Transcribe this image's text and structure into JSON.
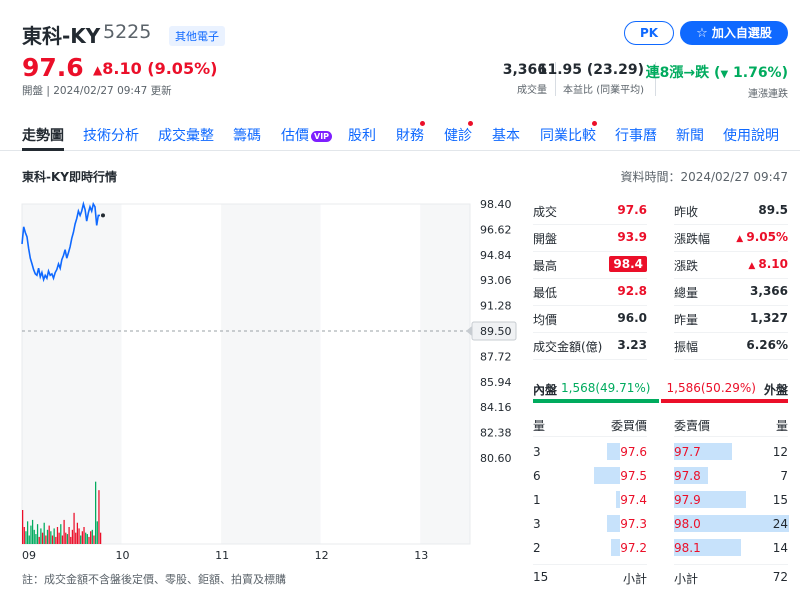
{
  "header": {
    "name": "東科-KY",
    "code": "5225",
    "category": "其他電子",
    "price": "97.6",
    "change": "8.10 (9.05%)",
    "status": "開盤 | 2024/02/27 09:47 更新",
    "pk_label": "PK",
    "watch_label": "加入自選股",
    "stats": [
      {
        "value": "3,366",
        "label": "成交量"
      },
      {
        "value": "11.95 (23.29)",
        "label": "本益比 (同業平均)"
      },
      {
        "value_prefix": "連8漲→跌 (",
        "value_change": "1.76%",
        "value_suffix": ")",
        "label": "連漲連跌"
      }
    ]
  },
  "tabs": [
    {
      "label": "走勢圖",
      "active": true
    },
    {
      "label": "技術分析"
    },
    {
      "label": "成交彙整"
    },
    {
      "label": "籌碼"
    },
    {
      "label": "估價",
      "badge": "VIP"
    },
    {
      "label": "股利"
    },
    {
      "label": "財務",
      "dot": true
    },
    {
      "label": "健診",
      "dot": true
    },
    {
      "label": "基本"
    },
    {
      "label": "同業比較",
      "dot": true
    },
    {
      "label": "行事曆"
    },
    {
      "label": "新聞"
    },
    {
      "label": "使用說明"
    }
  ],
  "section_title": "東科-KY即時行情",
  "data_time": "資料時間：2024/02/27 09:47",
  "footnote": "註：成交金額不含盤後定價、零股、鉅額、拍賣及標購",
  "chart_data": {
    "type": "line",
    "y_ticks": [
      "98.40",
      "96.62",
      "94.84",
      "93.06",
      "91.28",
      "89.50",
      "87.72",
      "85.94",
      "84.16",
      "82.38",
      "80.60"
    ],
    "ylim": [
      80.6,
      98.4
    ],
    "reference": "89.50",
    "x_ticks": [
      "09",
      "10",
      "11",
      "12",
      "13"
    ],
    "price_series": {
      "x_minutes": [
        0,
        1,
        2,
        3,
        4,
        5,
        6,
        7,
        8,
        9,
        10,
        11,
        12,
        13,
        14,
        15,
        16,
        17,
        18,
        19,
        20,
        21,
        22,
        23,
        24,
        25,
        26,
        27,
        28,
        29,
        30,
        31,
        32,
        33,
        34,
        35,
        36,
        37,
        38,
        39,
        40,
        41,
        42,
        43,
        44,
        45,
        46,
        47
      ],
      "values": [
        95.6,
        96.8,
        96.4,
        96.1,
        95.3,
        94.6,
        94.2,
        93.8,
        93.5,
        93.4,
        93.9,
        93.3,
        93.6,
        93.1,
        93.4,
        93.2,
        93.7,
        93.4,
        93.5,
        93.2,
        93.6,
        93.8,
        94.2,
        93.9,
        94.5,
        94.8,
        95.2,
        94.6,
        95.0,
        95.4,
        96.0,
        96.4,
        97.0,
        97.4,
        97.9,
        97.6,
        97.9,
        98.4,
        98.0,
        97.2,
        97.8,
        98.2,
        97.9,
        98.4,
        98.2,
        96.9,
        97.6,
        97.6
      ]
    },
    "volume_series": {
      "x_minutes": [
        0,
        1,
        2,
        3,
        4,
        5,
        6,
        7,
        8,
        9,
        10,
        11,
        12,
        13,
        14,
        15,
        16,
        17,
        18,
        19,
        20,
        21,
        22,
        23,
        24,
        25,
        26,
        27,
        28,
        29,
        30,
        31,
        32,
        33,
        34,
        35,
        36,
        37,
        38,
        39,
        40,
        41,
        42,
        43,
        44,
        45,
        46,
        47
      ],
      "values": [
        120,
        60,
        45,
        80,
        30,
        65,
        85,
        50,
        35,
        70,
        25,
        55,
        40,
        75,
        30,
        50,
        65,
        45,
        30,
        55,
        25,
        60,
        40,
        70,
        30,
        85,
        40,
        35,
        60,
        25,
        50,
        110,
        40,
        75,
        55,
        30,
        45,
        60,
        40,
        35,
        25,
        45,
        50,
        30,
        220,
        80,
        190,
        40
      ],
      "vmax": 240
    }
  },
  "quote": {
    "left": [
      {
        "label": "成交",
        "value": "97.6",
        "color": "red"
      },
      {
        "label": "開盤",
        "value": "93.9",
        "color": "red"
      },
      {
        "label": "最高",
        "value": "98.4",
        "color": "hl"
      },
      {
        "label": "最低",
        "value": "92.8",
        "color": "red"
      },
      {
        "label": "均價",
        "value": "96.0",
        "color": "black"
      },
      {
        "label": "成交金額(億)",
        "value": "3.23",
        "color": "black"
      }
    ],
    "right": [
      {
        "label": "昨收",
        "value": "89.5",
        "color": "black"
      },
      {
        "label": "漲跌幅",
        "value": "9.05%",
        "color": "red",
        "arrow": true
      },
      {
        "label": "漲跌",
        "value": "8.10",
        "color": "red",
        "arrow": true
      },
      {
        "label": "總量",
        "value": "3,366",
        "color": "black"
      },
      {
        "label": "昨量",
        "value": "1,327",
        "color": "black"
      },
      {
        "label": "振幅",
        "value": "6.26%",
        "color": "black"
      }
    ]
  },
  "ratio": {
    "inner_label": "內盤",
    "inner_value": "1,568",
    "inner_pct": "(49.71%)",
    "outer_value": "1,586",
    "outer_pct": "(50.29%)",
    "outer_label": "外盤",
    "inner_fraction": 0.4971
  },
  "orderbook": {
    "headers": {
      "bid_qty": "量",
      "bid_price": "委買價",
      "ask_price": "委賣價",
      "ask_qty": "量"
    },
    "bids": [
      {
        "qty": "3",
        "price": "97.6",
        "qty_num": 3
      },
      {
        "qty": "6",
        "price": "97.5",
        "qty_num": 6
      },
      {
        "qty": "1",
        "price": "97.4",
        "qty_num": 1
      },
      {
        "qty": "3",
        "price": "97.3",
        "qty_num": 3
      },
      {
        "qty": "2",
        "price": "97.2",
        "qty_num": 2
      }
    ],
    "asks": [
      {
        "price": "97.7",
        "qty": "12",
        "qty_num": 12
      },
      {
        "price": "97.8",
        "qty": "7",
        "qty_num": 7
      },
      {
        "price": "97.9",
        "qty": "15",
        "qty_num": 15
      },
      {
        "price": "98.0",
        "qty": "24",
        "qty_num": 24
      },
      {
        "price": "98.1",
        "qty": "14",
        "qty_num": 14
      }
    ],
    "bid_total_qty": "15",
    "bid_total_label": "小計",
    "ask_total_label": "小計",
    "ask_total_qty": "72"
  },
  "colors": {
    "up": "#eb0f29",
    "down": "#00ab5e",
    "accent": "#0f69ff",
    "line": "#0f69ff"
  }
}
